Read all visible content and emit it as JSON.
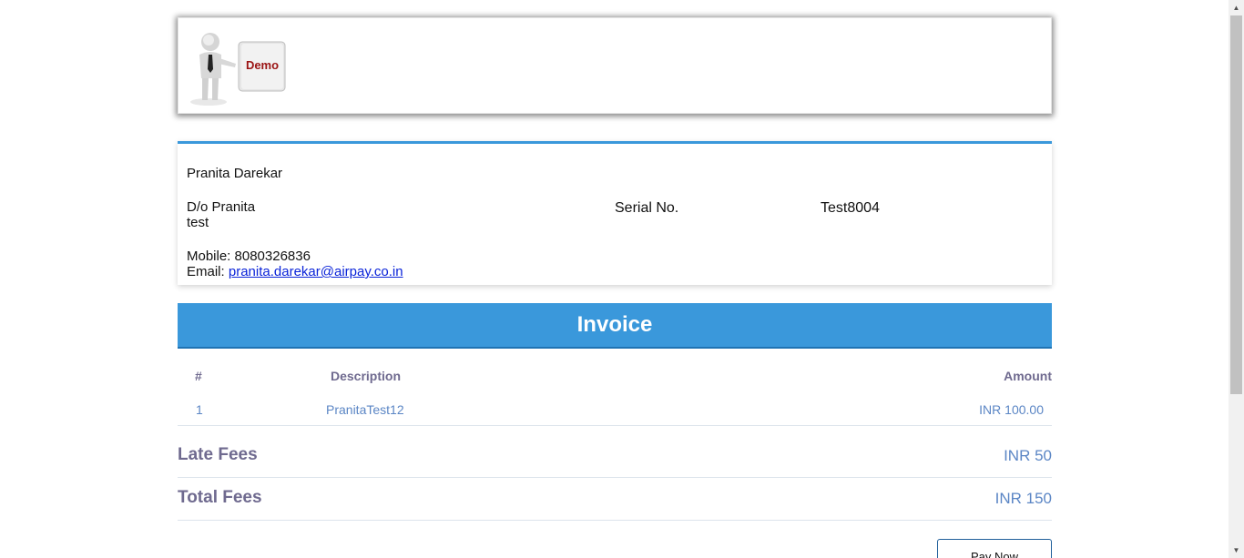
{
  "header": {
    "logo_text": "Demo"
  },
  "customer": {
    "name": "Pranita Darekar",
    "relation": "D/o Pranita",
    "address": "test",
    "mobile_label": "Mobile:",
    "mobile": "8080326836",
    "email_label": "Email:",
    "email": "pranita.darekar@airpay.co.in",
    "serial_label": "Serial No.",
    "serial_value": "Test8004"
  },
  "invoice": {
    "title": "Invoice",
    "columns": {
      "num": "#",
      "description": "Description",
      "amount": "Amount"
    },
    "rows": [
      {
        "num": "1",
        "description": "PranitaTest12",
        "amount": "INR 100.00"
      }
    ]
  },
  "fees": {
    "late_label": "Late Fees",
    "late_value": "INR 50",
    "total_label": "Total Fees",
    "total_value": "INR 150"
  },
  "actions": {
    "pay_label": "Pay Now"
  },
  "colors": {
    "accent": "#3a98db",
    "label_purple": "#6f6a8f",
    "value_blue": "#5b86c5",
    "link": "#0b24d9"
  },
  "icons": {
    "logo": "presenter-with-demo-board-icon",
    "scroll_up": "scroll-up-arrow-icon",
    "scroll_down": "scroll-down-arrow-icon"
  }
}
